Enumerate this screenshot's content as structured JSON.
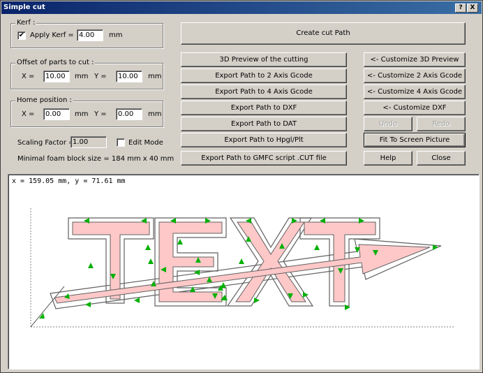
{
  "window": {
    "title": "Simple cut",
    "help_btn": "?",
    "close_btn": "X"
  },
  "kerf": {
    "group_title": "Kerf :",
    "apply_label": "Apply Kerf =",
    "apply_checked": true,
    "value": "4.00",
    "unit": "mm"
  },
  "offset": {
    "group_title": "Offset of parts to cut :",
    "x_label": "X =",
    "x_value": "10.00",
    "x_unit": "mm",
    "y_label": "Y =",
    "y_value": "10.00",
    "y_unit": "mm"
  },
  "home": {
    "group_title": "Home position :",
    "x_label": "X =",
    "x_value": "0.00",
    "x_unit": "mm",
    "y_label": "Y =",
    "y_value": "0.00",
    "y_unit": "mm"
  },
  "scaling": {
    "label": "Scaling Factor =",
    "value": "1.00",
    "edit_mode_label": "Edit Mode",
    "edit_mode_checked": false
  },
  "foam_block": "Minimal foam block size = 184 mm x 40 mm",
  "buttons": {
    "create_cut_path": "Create cut Path",
    "preview_3d": "3D Preview of the cutting",
    "export_2axis": "Export Path to 2 Axis Gcode",
    "export_4axis": "Export Path to 4 Axis Gcode",
    "export_dxf": "Export Path to DXF",
    "export_dat": "Export Path to DAT",
    "export_hpgl": "Export Path to Hpgl/Plt",
    "export_gmfc": "Export Path to GMFC script  .CUT file",
    "customize_3d": "<- Customize 3D Preview",
    "customize_2axis": "<- Customize 2 Axis Gcode",
    "customize_4axis": "<- Customize 4 Axis Gcode",
    "customize_dxf": "<- Customize DXF",
    "undo": "Undo",
    "redo": "Redo",
    "fit_to_screen": "Fit To Screen Picture",
    "help": "Help",
    "close": "Close"
  },
  "canvas": {
    "coords": "x = 159.05 mm, y = 71.61 mm",
    "artwork_text": "TEXT",
    "colors": {
      "fill": "#ffc8c8",
      "outline": "#606060",
      "arrow": "#00c000",
      "guide": "#808080"
    }
  }
}
